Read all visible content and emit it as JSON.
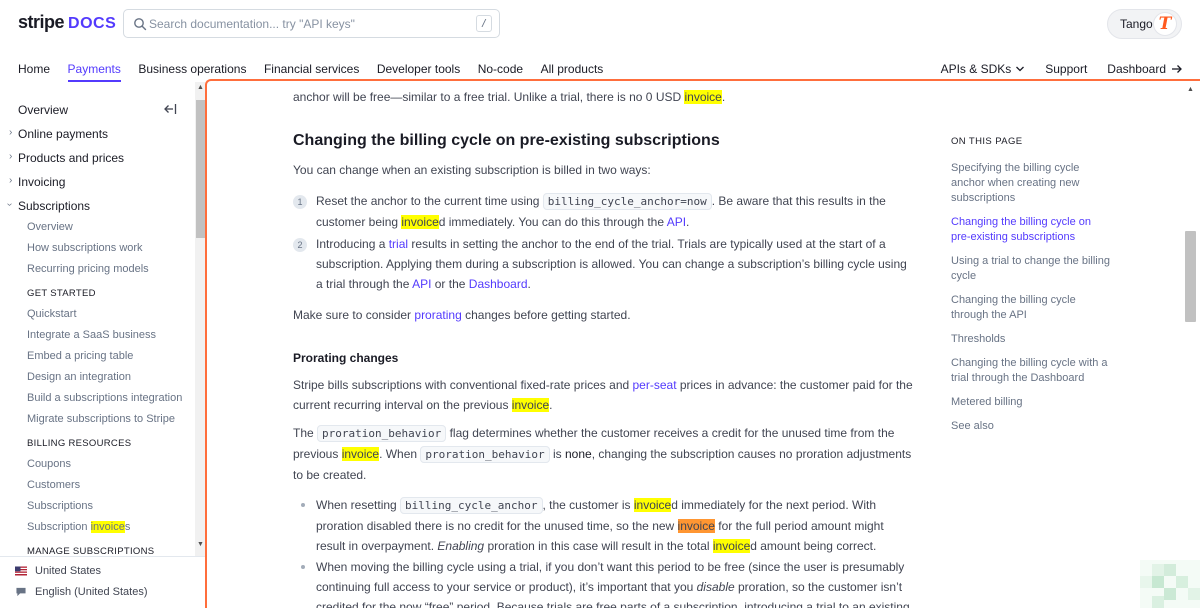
{
  "header": {
    "logo_brand": "stripe",
    "logo_product": "DOCS",
    "search_placeholder": "Search documentation... try \"API keys\"",
    "search_shortcut": "/",
    "account_name": "Tango",
    "account_initial": "T",
    "nav": [
      "Home",
      "Payments",
      "Business operations",
      "Financial services",
      "Developer tools",
      "No-code",
      "All products"
    ],
    "active_nav": "Payments",
    "right_nav": {
      "apis": "APIs & SDKs",
      "support": "Support",
      "dashboard": "Dashboard"
    }
  },
  "sidebar": {
    "items": [
      {
        "label": "Overview",
        "chev": false
      },
      {
        "label": "Online payments",
        "chev": true
      },
      {
        "label": "Products and prices",
        "chev": true
      },
      {
        "label": "Invoicing",
        "chev": true
      },
      {
        "label": "Subscriptions",
        "chev": true
      }
    ],
    "sub": [
      "Overview",
      "How subscriptions work",
      "Recurring pricing models"
    ],
    "section_get_started": "GET STARTED",
    "get_started": [
      "Quickstart",
      "Integrate a SaaS business",
      "Embed a pricing table",
      "Design an integration",
      "Build a subscriptions integration",
      "Migrate subscriptions to Stripe"
    ],
    "section_billing": "BILLING RESOURCES",
    "billing": [
      "Coupons",
      "Customers",
      "Subscriptions"
    ],
    "billing_last_prefix": "Subscription ",
    "billing_last_match": "invoice",
    "billing_last_suffix": "s",
    "section_manage": "MANAGE SUBSCRIPTIONS",
    "footer": {
      "country": "United States",
      "language": "English (United States)"
    }
  },
  "article": {
    "intro_text": "anchor will be free—similar to a free trial. Unlike a trial, there is no 0 USD ",
    "intro_match": "invoice",
    "intro_end": ".",
    "h2": "Changing the billing cycle on pre-existing subscriptions",
    "lead": "You can change when an existing subscription is billed in two ways:",
    "step1": {
      "n": "1",
      "a": "Reset the anchor to the current time using ",
      "code": "billing_cycle_anchor=now",
      "b": ". Be aware that this results in the customer being ",
      "match": "invoice",
      "c": "d immediately. You can do this through the ",
      "link": "API",
      "d": "."
    },
    "step2": {
      "n": "2",
      "a": "Introducing a ",
      "link1": "trial",
      "b": " results in setting the anchor to the end of the trial. Trials are typically used at the start of a subscription. Applying them during a subscription is allowed. You can change a subscription’s billing cycle using a trial through the ",
      "link2": "API",
      "c": " or the ",
      "link3": "Dashboard",
      "d": "."
    },
    "consider": {
      "a": "Make sure to consider ",
      "link": "prorating",
      "b": " changes before getting started."
    },
    "h3": "Prorating changes",
    "para1": {
      "a": "Stripe bills subscriptions with conventional fixed-rate prices and ",
      "link": "per-seat",
      "b": " prices in advance: the customer paid for the current recurring interval on the previous ",
      "match": "invoice",
      "c": "."
    },
    "para2": {
      "a": "The ",
      "code1": "proration_behavior",
      "b": " flag determines whether the customer receives a credit for the unused time from the previous ",
      "match": "invoice",
      "c": ". When ",
      "code2": "proration_behavior",
      "d": " is ",
      "none": "none",
      "e": ", changing the subscription causes no proration adjustments to be created."
    },
    "bullet1": {
      "a": "When resetting ",
      "code": "billing_cycle_anchor",
      "b": ", the customer is ",
      "match1": "invoice",
      "c": "d immediately for the next period. With proration disabled there is no credit for the unused time, so the new ",
      "match2": "invoice",
      "d": " for the full period amount might result in overpayment. ",
      "em": "Enabling",
      "e": " proration in this case will result in the total ",
      "match3": "invoice",
      "f": "d amount being correct."
    },
    "bullet2": {
      "a": "When moving the billing cycle using a trial, if you don’t want this period to be free (since the user is presumably continuing full access to your service or product), it’s important that you ",
      "em": "disable",
      "b": " proration, so the customer isn’t credited for the now “free” period. Because trials are free parts of a subscription, introducing a trial to an existing"
    }
  },
  "toc": {
    "title": "ON THIS PAGE",
    "items": [
      "Specifying the billing cycle anchor when creating new subscriptions",
      "Changing the billing cycle on pre-existing subscriptions",
      "Using a trial to change the billing cycle",
      "Changing the billing cycle through the API",
      "Thresholds",
      "Changing the billing cycle with a trial through the Dashboard",
      "Metered billing",
      "See also"
    ],
    "active": "Changing the billing cycle on pre-existing subscriptions"
  },
  "colors": {
    "accent": "#533afd",
    "highlight": "#ffff00",
    "current_match": "#ff9632",
    "frame": "#ff6e3c"
  }
}
